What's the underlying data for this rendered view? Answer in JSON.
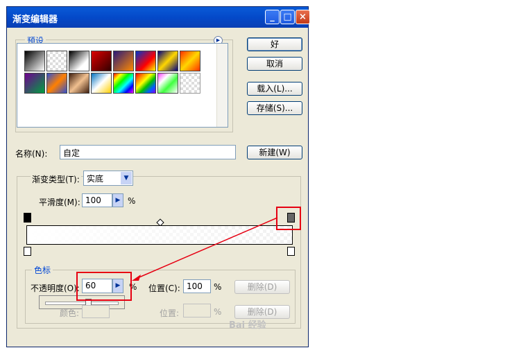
{
  "window": {
    "title": "渐变编辑器"
  },
  "titlebar_buttons": {
    "minimize": "_",
    "maximize": "□",
    "close": "×"
  },
  "presets": {
    "legend": "预设"
  },
  "buttons": {
    "ok": "好",
    "cancel": "取消",
    "load": "载入(L)...",
    "save": "存储(S)...",
    "new": "新建(W)"
  },
  "name": {
    "label": "名称(N):",
    "value": "自定"
  },
  "gradient": {
    "type_label": "渐变类型(T):",
    "type_value": "实底",
    "smoothness_label": "平滑度(M):",
    "smoothness_value": "100",
    "smoothness_unit": "%"
  },
  "stops": {
    "legend": "色标",
    "opacity_label": "不透明度(O):",
    "opacity_value": "60",
    "opacity_unit": "%",
    "location_label": "位置(C):",
    "location_value": "100",
    "location_unit": "%",
    "delete_label": "删除(D)",
    "color_label": "颜色:",
    "location2_label": "位置:",
    "location2_unit": "%",
    "delete2_label": "删除(D)"
  },
  "watermark": "Bai 经验"
}
